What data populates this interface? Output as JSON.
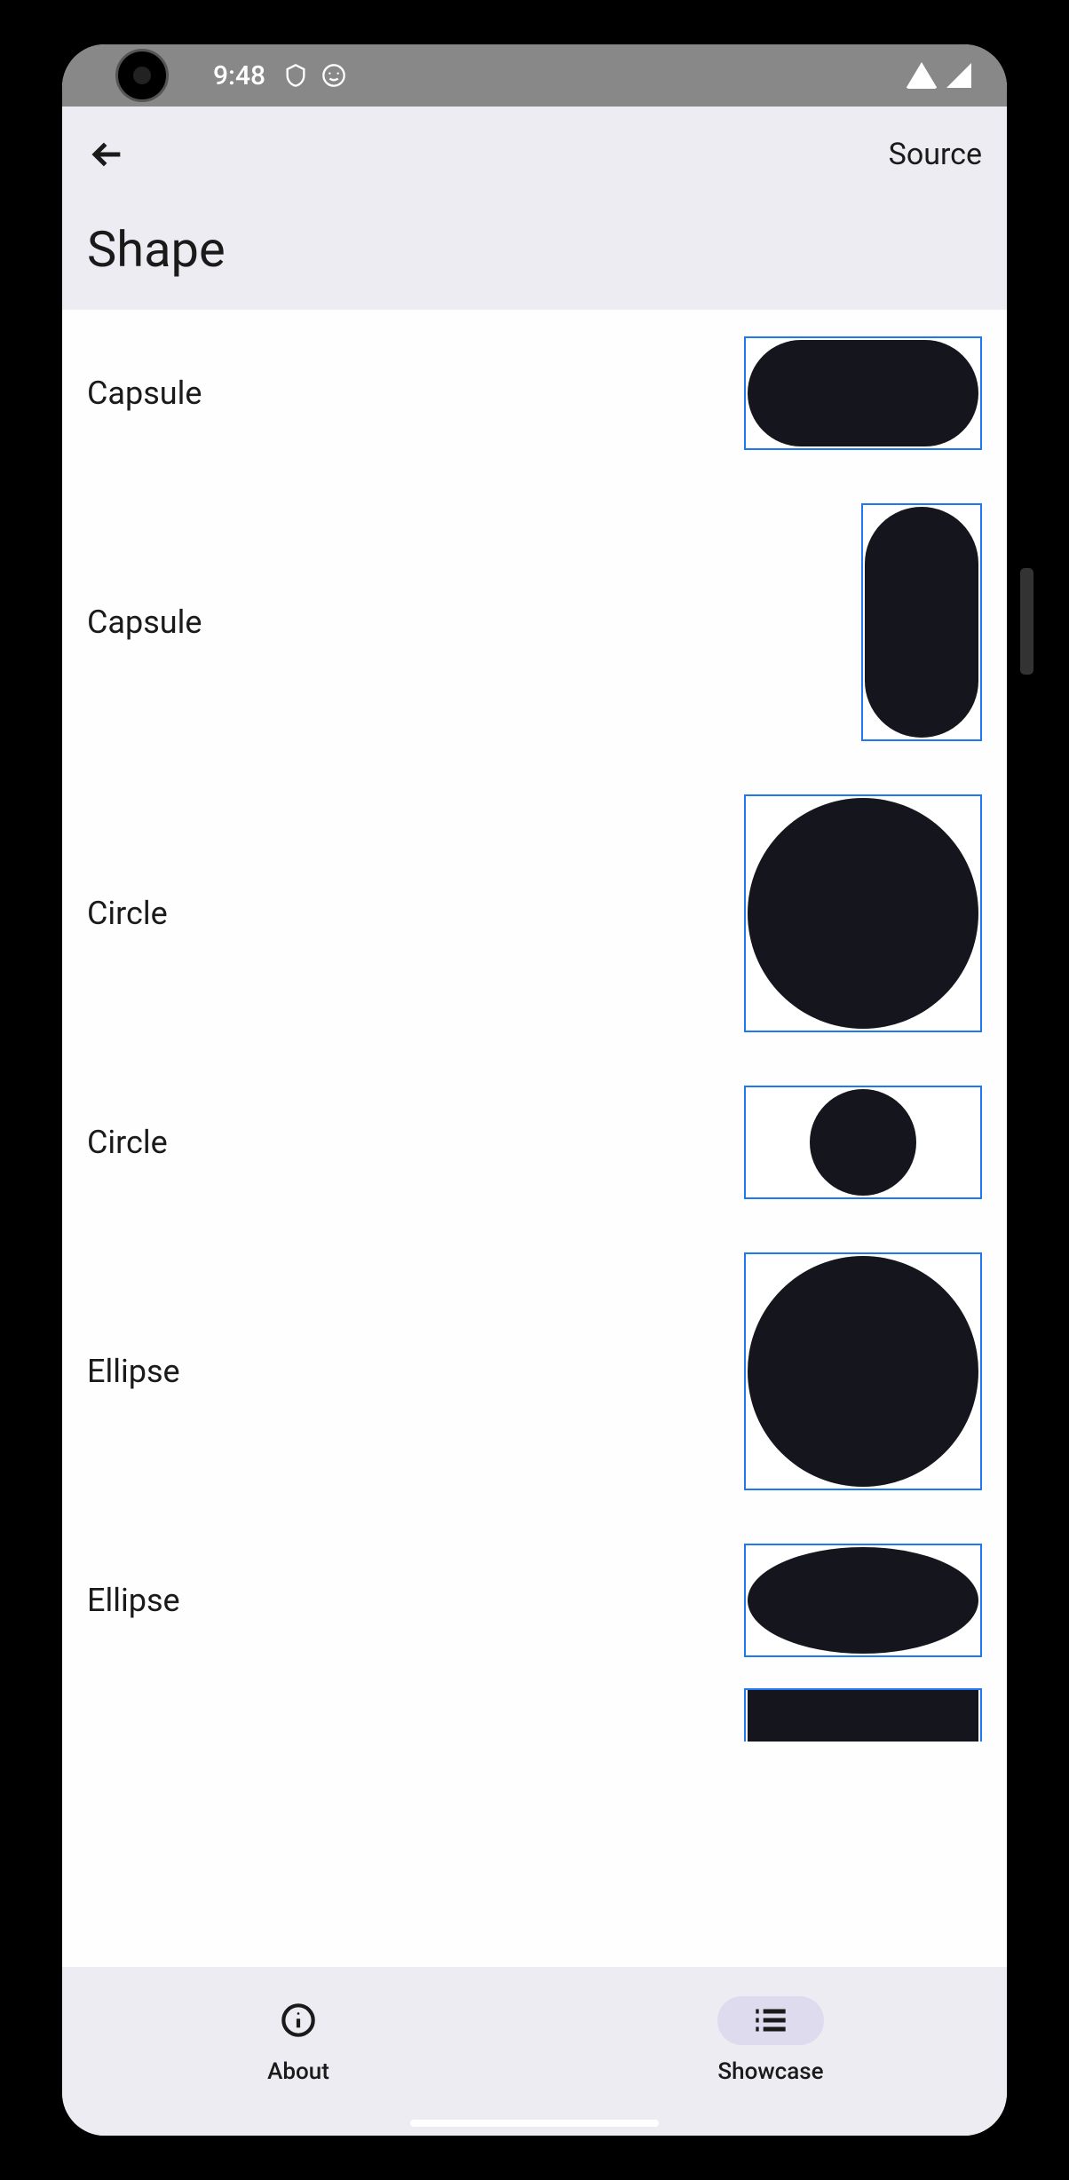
{
  "status_bar": {
    "time": "9:48"
  },
  "header": {
    "source_label": "Source",
    "title": "Shape"
  },
  "shapes": [
    {
      "label": "Capsule",
      "type": "capsule-h"
    },
    {
      "label": "Capsule",
      "type": "capsule-v"
    },
    {
      "label": "Circle",
      "type": "circle-large"
    },
    {
      "label": "Circle",
      "type": "circle-small"
    },
    {
      "label": "Ellipse",
      "type": "ellipse-large"
    },
    {
      "label": "Ellipse",
      "type": "ellipse-wide"
    }
  ],
  "bottom_nav": {
    "about": "About",
    "showcase": "Showcase"
  },
  "colors": {
    "shape_fill": "#15151d",
    "shape_border": "#1e78f0",
    "header_bg": "#edecf2",
    "status_bg": "#888888"
  }
}
